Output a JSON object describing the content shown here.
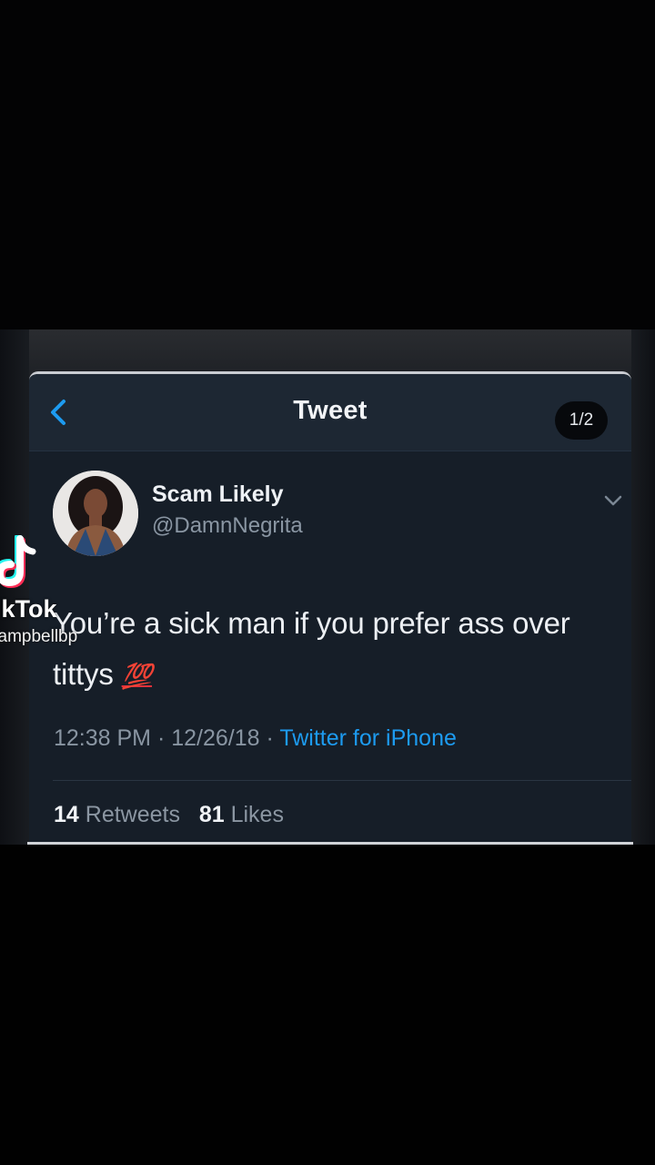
{
  "navbar": {
    "title": "Tweet",
    "page_indicator": "1/2",
    "back_icon": "chevron-left-icon"
  },
  "tweet": {
    "display_name": "Scam Likely",
    "handle": "@DamnNegrita",
    "text": "You’re a sick man if you prefer ass over tittys",
    "emoji": "💯",
    "time": "12:38 PM",
    "date": "12/26/18",
    "source": "Twitter for iPhone",
    "retweets_count": "14",
    "retweets_label": "Retweets",
    "likes_count": "81",
    "likes_label": "Likes"
  },
  "watermark": {
    "brand": "TikTok",
    "username": "campbellbp"
  },
  "colors": {
    "accent": "#1d9bf0",
    "background": "#161e28",
    "emoji": "#e0313b"
  }
}
